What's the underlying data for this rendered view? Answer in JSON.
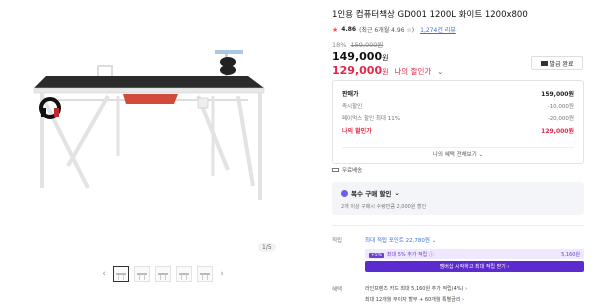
{
  "product": {
    "title": "1인용 컴퓨터책상 GD001 1200L 화이트 1200x800",
    "rating": "4.86",
    "rating_note": "(최근 6개월 4.96 ☆)",
    "reviews": "1,274건 리뷰",
    "discount_rate": "18%",
    "original_price": "159,000원",
    "price": "149,000",
    "price_unit": "원",
    "my_price": "129,000",
    "my_price_unit": "원",
    "my_price_label": "나의 할인가",
    "my_price_chevron": "⌄",
    "coupon_button": "발급 완료"
  },
  "breakdown": {
    "rows": [
      {
        "label": "판매가",
        "value": "159,000원"
      },
      {
        "label": "즉시할인",
        "value": "-10,000원"
      },
      {
        "label": "페이먹스 할인 최대 11%",
        "value": "-20,000원"
      }
    ],
    "mine_label": "나의 할인가",
    "mine_value": "129,000원",
    "view_all": "나의 혜택 전체보기 ⌄"
  },
  "shipping": {
    "label": "무료배송"
  },
  "multi_buy": {
    "title": "복수 구매 할인",
    "chevron": "⌄",
    "desc": "2개 이상 구매시 수량만큼 2,000원 할인"
  },
  "points": {
    "label": "적립",
    "text": "최대 적립 포인트 22,780원 ⌄",
    "plus_badge": "+5%",
    "plus_text": "최대 5% 추가 적립 ⓘ",
    "plus_amount": "5,160원",
    "plus_button": "멤버십 시작하고 최대 적립 받기 ›"
  },
  "benefits": {
    "label": "혜택",
    "line1": "라인프렌즈 카드 최대 5,160원 추가 적립(4%) ›",
    "line2": "최대 12개월 무이자 할부 + 60개월 특별금리",
    "more": "›"
  },
  "gallery": {
    "counter": "1/5",
    "prev": "‹",
    "next": "›"
  },
  "colors": {
    "accent_red": "#e0284a",
    "link_blue": "#3b6fd6",
    "membership_purple": "#5b2bd0"
  }
}
